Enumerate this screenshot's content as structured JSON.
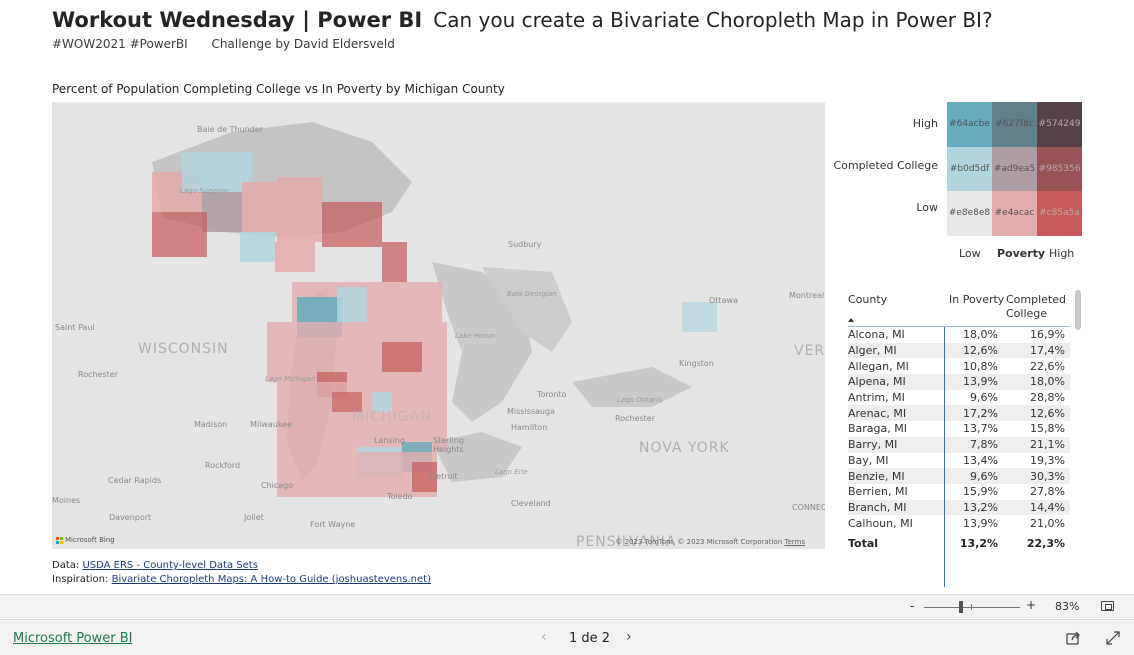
{
  "header": {
    "title_main": "Workout Wednesday | Power BI",
    "title_sub": "Can you create a Bivariate Choropleth Map in Power BI?",
    "tags": "#WOW2021 #PowerBI",
    "credit": "Challenge by David Eldersveld"
  },
  "map": {
    "title": "Percent of Population Completing College vs In Poverty by Michigan County",
    "places": {
      "baie": "Baie de Thunder",
      "lago_superior": "Lago Superior",
      "sudbury": "Sudbury",
      "baia_georgian": "Baía Georgian",
      "ottawa": "Ottawa",
      "montreal": "Montreal",
      "saint_paul": "Saint Paul",
      "wisconsin": "WISCONSIN",
      "lake_huron": "Lake Huron",
      "kingston": "Kingston",
      "rochester_w": "Rochester",
      "lago_michigan": "Lago Michigan",
      "toronto": "Toronto",
      "mississauga": "Mississauga",
      "lago_ontario": "Lago Ontario",
      "rochester_e": "Rochester",
      "madison": "Madison",
      "milwaukee": "Milwaukee",
      "michigan": "MICHIGAN",
      "lansing": "Lansing",
      "sterling": "Sterling Heights",
      "hamilton": "Hamilton",
      "nova_york": "NOVA YORK",
      "rockford": "Rockford",
      "detroit": "Detroit",
      "lago_erie": "Lago Erie",
      "cedar_rapids": "Cedar Rapids",
      "chicago": "Chicago",
      "toledo": "Toledo",
      "cleveland": "Cleveland",
      "moines": "Moines",
      "davenport": "Davenport",
      "joliet": "Joliet",
      "fort_wayne": "Fort Wayne",
      "pensilvania": "PENSILVANIA",
      "vermont": "VERM",
      "connec": "CONNEC"
    },
    "bing": "Microsoft Bing",
    "attribution": "© 2023 TomTom, © 2023 Microsoft Corporation",
    "terms": "Terms"
  },
  "legend": {
    "y_high": "High",
    "y_title": "Completed College",
    "y_low": "Low",
    "x_low": "Low",
    "x_title": "Poverty",
    "x_high": "High",
    "cells": [
      [
        "#64acbe",
        "#627f8c",
        "#574249"
      ],
      [
        "#b0d5df",
        "#ad9ea5",
        "#985356"
      ],
      [
        "#e8e8e8",
        "#e4acac",
        "#c85a5a"
      ]
    ]
  },
  "table": {
    "col_county": "County",
    "col_poverty": "In Poverty",
    "col_college": "Completed College",
    "rows": [
      [
        "Alcona, MI",
        "18,0%",
        "16,9%"
      ],
      [
        "Alger, MI",
        "12,6%",
        "17,4%"
      ],
      [
        "Allegan, MI",
        "10,8%",
        "22,6%"
      ],
      [
        "Alpena, MI",
        "13,9%",
        "18,0%"
      ],
      [
        "Antrim, MI",
        "9,6%",
        "28,8%"
      ],
      [
        "Arenac, MI",
        "17,2%",
        "12,6%"
      ],
      [
        "Baraga, MI",
        "13,7%",
        "15,8%"
      ],
      [
        "Barry, MI",
        "7,8%",
        "21,1%"
      ],
      [
        "Bay, MI",
        "13,4%",
        "19,3%"
      ],
      [
        "Benzie, MI",
        "9,6%",
        "30,3%"
      ],
      [
        "Berrien, MI",
        "15,9%",
        "27,8%"
      ],
      [
        "Branch, MI",
        "13,2%",
        "14,4%"
      ],
      [
        "Calhoun, MI",
        "13,9%",
        "21,0%"
      ]
    ],
    "total_label": "Total",
    "total_poverty": "13,2%",
    "total_college": "22,3%"
  },
  "notes": {
    "data_prefix": "Data:",
    "data_link": "USDA ERS - County-level Data Sets",
    "insp_prefix": "Inspiration:",
    "insp_link": "Bivariate Choropleth Maps: A How-to Guide (joshuastevens.net)"
  },
  "zoom": {
    "minus": "-",
    "plus": "+",
    "level": "83%"
  },
  "bottom": {
    "brand": "Microsoft Power BI",
    "page": "1 de 2"
  }
}
